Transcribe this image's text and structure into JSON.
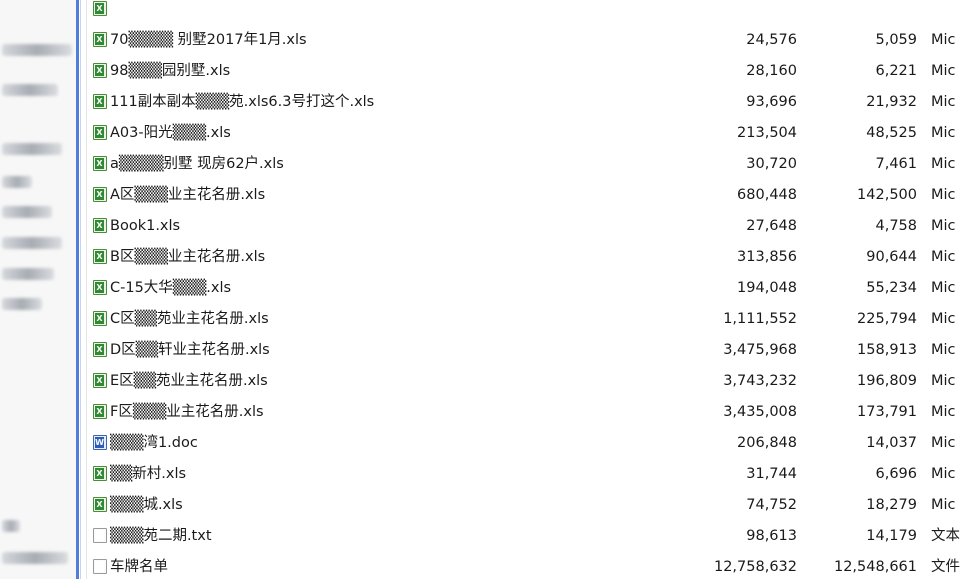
{
  "file_list": {
    "rows": [
      {
        "name": "",
        "size": "",
        "packed": "",
        "type": "",
        "icon": "xls-icon",
        "partial": "top"
      },
      {
        "name": "70▒▒▒▒ 别墅2017年1月.xls",
        "size": "24,576",
        "packed": "5,059",
        "type": "Mic",
        "icon": "xls-icon"
      },
      {
        "name": "98▒▒▒园别墅.xls",
        "size": "28,160",
        "packed": "6,221",
        "type": "Mic",
        "icon": "xls-icon"
      },
      {
        "name": "111副本副本▒▒▒苑.xls6.3号打这个.xls",
        "size": "93,696",
        "packed": "21,932",
        "type": "Mic",
        "icon": "xls-icon"
      },
      {
        "name": "A03-阳光▒▒▒.xls",
        "size": "213,504",
        "packed": "48,525",
        "type": "Mic",
        "icon": "xls-icon"
      },
      {
        "name": "a▒▒▒▒别墅 现房62户.xls",
        "size": "30,720",
        "packed": "7,461",
        "type": "Mic",
        "icon": "xls-icon"
      },
      {
        "name": "A区▒▒▒业主花名册.xls",
        "size": "680,448",
        "packed": "142,500",
        "type": "Mic",
        "icon": "xls-icon"
      },
      {
        "name": "Book1.xls",
        "size": "27,648",
        "packed": "4,758",
        "type": "Mic",
        "icon": "xls-icon"
      },
      {
        "name": "B区▒▒▒业主花名册.xls",
        "size": "313,856",
        "packed": "90,644",
        "type": "Mic",
        "icon": "xls-icon"
      },
      {
        "name": "C-15大华▒▒▒.xls",
        "size": "194,048",
        "packed": "55,234",
        "type": "Mic",
        "icon": "xls-icon"
      },
      {
        "name": "C区▒▒苑业主花名册.xls",
        "size": "1,111,552",
        "packed": "225,794",
        "type": "Mic",
        "icon": "xls-icon"
      },
      {
        "name": "D区▒▒轩业主花名册.xls",
        "size": "3,475,968",
        "packed": "158,913",
        "type": "Mic",
        "icon": "xls-icon"
      },
      {
        "name": "E区▒▒苑业主花名册.xls",
        "size": "3,743,232",
        "packed": "196,809",
        "type": "Mic",
        "icon": "xls-icon"
      },
      {
        "name": "F区▒▒▒业主花名册.xls",
        "size": "3,435,008",
        "packed": "173,791",
        "type": "Mic",
        "icon": "xls-icon"
      },
      {
        "name": "▒▒▒湾1.doc",
        "size": "206,848",
        "packed": "14,037",
        "type": "Mic",
        "icon": "doc-icon"
      },
      {
        "name": "▒▒新村.xls",
        "size": "31,744",
        "packed": "6,696",
        "type": "Mic",
        "icon": "xls-icon"
      },
      {
        "name": "▒▒▒城.xls",
        "size": "74,752",
        "packed": "18,279",
        "type": "Mic",
        "icon": "xls-icon"
      },
      {
        "name": "▒▒▒苑二期.txt",
        "size": "98,613",
        "packed": "14,179",
        "type": "文本",
        "icon": "txt-icon"
      },
      {
        "name": "车牌名单",
        "size": "12,758,632",
        "packed": "12,548,661",
        "type": "文件",
        "icon": "txt-icon",
        "partial": "bottom"
      }
    ]
  },
  "colors": {
    "selection_line": "#4f7fd9",
    "xls_icon": "#2f8a33",
    "doc_icon": "#2d5bb5"
  }
}
